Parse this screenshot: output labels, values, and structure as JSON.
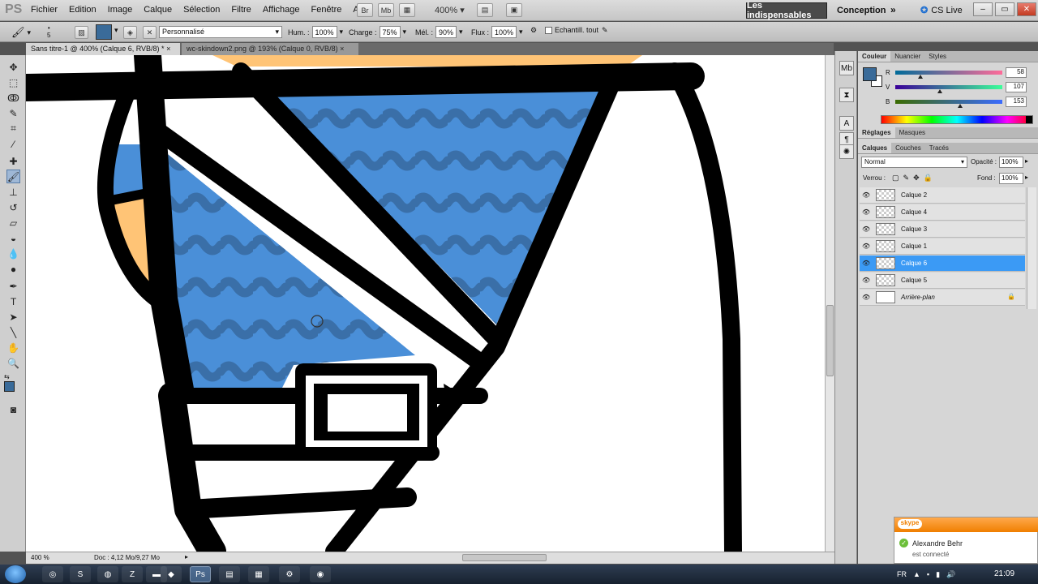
{
  "app": {
    "logo": "PS",
    "menus": [
      "Fichier",
      "Edition",
      "Image",
      "Calque",
      "Sélection",
      "Filtre",
      "Affichage",
      "Fenêtre",
      "Aide"
    ],
    "app_bar_buttons": [
      "Br",
      "Mb"
    ],
    "zoom_menu": "400%",
    "workspace_active": "Les indispensables",
    "workspace_other": "Conception",
    "more_workspaces": "»",
    "cs_live": "CS Live"
  },
  "options_bar": {
    "brush_size": "5",
    "foreground_color": "#3a6b99",
    "preset": "Personnalisé",
    "hum_label": "Hum. :",
    "hum_value": "100%",
    "charge_label": "Charge :",
    "charge_value": "75%",
    "mel_label": "Mél. :",
    "mel_value": "90%",
    "flux_label": "Flux :",
    "flux_value": "100%",
    "sample_all": "Echantill. tout"
  },
  "documents": {
    "tabs": [
      {
        "label": "Sans titre-1 @ 400% (Calque 6, RVB/8) *",
        "close": "×"
      },
      {
        "label": "wc-skindown2.png @ 193% (Calque 0, RVB/8)",
        "close": "×"
      }
    ],
    "active_tab": 0
  },
  "status_bar": {
    "zoom": "400 %",
    "doc_info": "Doc : 4,12 Mo/9,27 Mo"
  },
  "color_panel": {
    "tabs": [
      "Couleur",
      "Nuancier",
      "Styles"
    ],
    "r_label": "R",
    "r_value": "58",
    "v_label": "V",
    "v_value": "107",
    "b_label": "B",
    "b_value": "153"
  },
  "adjust_panel": {
    "tabs": [
      "Réglages",
      "Masques"
    ]
  },
  "layers_panel": {
    "tabs": [
      "Calques",
      "Couches",
      "Tracés"
    ],
    "blend_mode": "Normal",
    "opacity_label": "Opacité :",
    "opacity_value": "100%",
    "lock_label": "Verrou :",
    "fill_label": "Fond :",
    "fill_value": "100%",
    "layers": [
      {
        "name": "Calque 2"
      },
      {
        "name": "Calque 4"
      },
      {
        "name": "Calque 3"
      },
      {
        "name": "Calque 1"
      },
      {
        "name": "Calque 6"
      },
      {
        "name": "Calque 5"
      },
      {
        "name": "Arrière-plan"
      }
    ],
    "selected_layer": "Calque 6"
  },
  "skype": {
    "brand": "skype",
    "contact": "Alexandre Behr",
    "status": "est connecté"
  },
  "taskbar": {
    "language": "FR",
    "time": "21:09"
  },
  "colors": {
    "canvas_blue": "#4a8fd8",
    "wave_blue": "#3a6fa8",
    "outline": "#000000",
    "skin": "#ffc476",
    "selection": "#3b9af5"
  }
}
